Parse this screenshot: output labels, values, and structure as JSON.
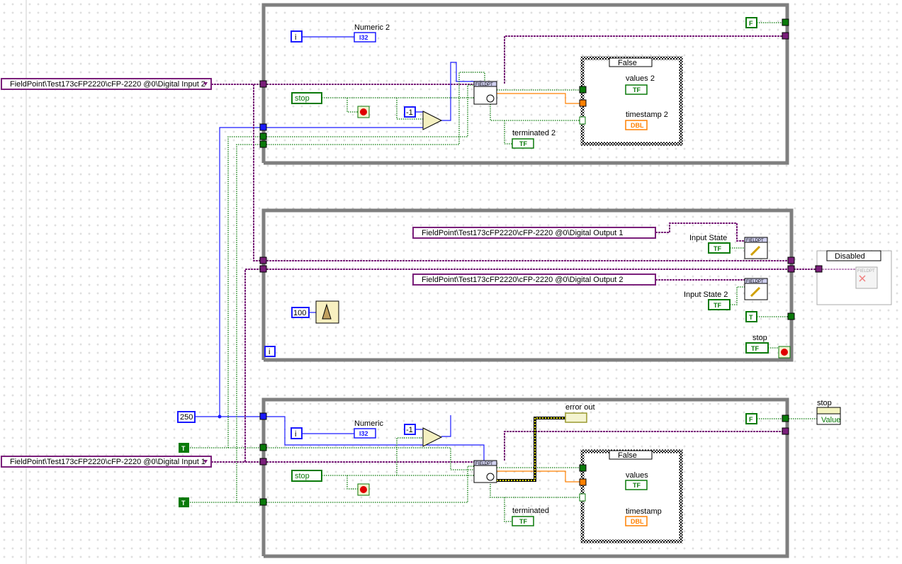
{
  "colors": {
    "refnum": "#7a1f7a",
    "boolean": "#0a7a0a",
    "integer": "#1a1aff",
    "double": "#ff8000",
    "error": "#d4d400",
    "structure": "#7f7f7f"
  },
  "top_loop": {
    "iteration_terminal": "i",
    "numeric_label": "Numeric 2",
    "numeric_type": "I32",
    "io_channel": "FieldPoint\\Test173cFP2220\\cFP-2220 @0\\Digital Input 2",
    "stop_local": "stop",
    "const_neg1": "-1",
    "node_label": "FIELDPT",
    "case_selector": "False",
    "values_label": "values 2",
    "values_type": "TF",
    "timestamp_label": "timestamp 2",
    "timestamp_type": "DBL",
    "terminated_label": "terminated 2",
    "terminated_type": "TF",
    "false_const": "F"
  },
  "middle_loop": {
    "io_channel_1": "FieldPoint\\Test173cFP2220\\cFP-2220 @0\\Digital Output 1",
    "io_channel_2": "FieldPoint\\Test173cFP2220\\cFP-2220 @0\\Digital Output 2",
    "input_state_label": "Input State",
    "input_state_2_label": "Input State 2",
    "tf_type": "TF",
    "node_label": "FIELDPT",
    "wait_ms": "100",
    "true_const": "T",
    "stop_label": "stop",
    "iteration_terminal": "i"
  },
  "disabled_structure": {
    "selector": "Disabled",
    "node_label": "FIELDPT"
  },
  "bottom_loop": {
    "iteration_terminal": "i",
    "numeric_label": "Numeric",
    "numeric_type": "I32",
    "io_channel": "FieldPoint\\Test173cFP2220\\cFP-2220 @0\\Digital Input 1",
    "stop_local": "stop",
    "const_neg1": "-1",
    "node_label": "FIELDPT",
    "case_selector": "False",
    "values_label": "values",
    "values_type": "TF",
    "timestamp_label": "timestamp",
    "timestamp_type": "DBL",
    "terminated_label": "terminated",
    "terminated_type": "TF",
    "error_out_label": "error out",
    "false_const": "F",
    "stop_property_label": "stop",
    "stop_property_value": "Value"
  },
  "left_constants": {
    "period": "250",
    "true_1": "T",
    "true_2": "T"
  }
}
